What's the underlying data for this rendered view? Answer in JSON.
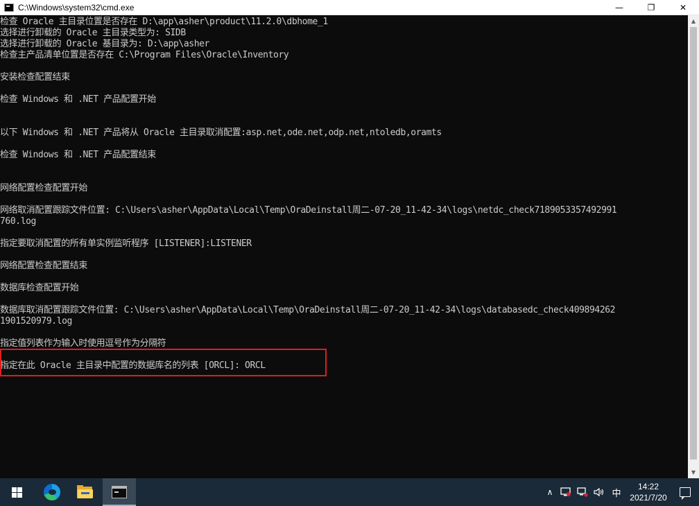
{
  "window": {
    "title": "C:\\Windows\\system32\\cmd.exe",
    "minimize": "—",
    "maximize": "❐",
    "close": "✕"
  },
  "console": {
    "lines": [
      "检查 Oracle 主目录位置是否存在 D:\\app\\asher\\product\\11.2.0\\dbhome_1",
      "选择进行卸载的 Oracle 主目录类型为: SIDB",
      "选择进行卸载的 Oracle 基目录为: D:\\app\\asher",
      "检查主产品清单位置是否存在 C:\\Program Files\\Oracle\\Inventory",
      "安装检查配置结束",
      "检查 Windows 和 .NET 产品配置开始",
      "以下 Windows 和 .NET 产品将从 Oracle 主目录取消配置:asp.net,ode.net,odp.net,ntoledb,oramts",
      "检查 Windows 和 .NET 产品配置结束",
      "网络配置检查配置开始",
      "网络取消配置跟踪文件位置: C:\\Users\\asher\\AppData\\Local\\Temp\\OraDeinstall周二-07-20_11-42-34\\logs\\netdc_check7189053357492991",
      "760.log",
      "指定要取消配置的所有单实例监听程序 [LISTENER]:LISTENER",
      "网络配置检查配置结束",
      "数据库检查配置开始",
      "数据库取消配置跟踪文件位置: C:\\Users\\asher\\AppData\\Local\\Temp\\OraDeinstall周二-07-20_11-42-34\\logs\\databasedc_check409894262",
      "1901520979.log",
      "指定值列表作为输入时使用逗号作为分隔符",
      "指定在此 Oracle 主目录中配置的数据库名的列表 [ORCL]: ORCL"
    ]
  },
  "scrollbar": {
    "up": "▲",
    "down": "▼"
  },
  "taskbar": {
    "ime": "中",
    "chevron": "∧",
    "time": "14:22",
    "date": "2021/7/20"
  },
  "colors": {
    "console_bg": "#0c0c0c",
    "console_text": "#cccccc",
    "highlight": "#e11d1d",
    "taskbar_bg": "#1b2a38"
  }
}
